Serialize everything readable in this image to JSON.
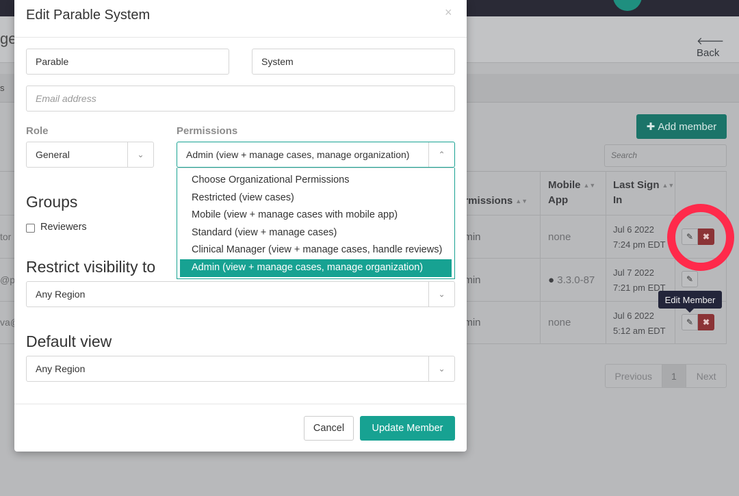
{
  "background": {
    "page_title_fragment": "ge",
    "back_label": "Back",
    "tab_fragment": "s",
    "add_member_label": "Add member",
    "search_placeholder": "Search",
    "table": {
      "headers": {
        "permissions": "Permissions",
        "mobile_app_1": "Mobile",
        "mobile_app_2": "App",
        "last_sign_in_1": "Last Sign",
        "last_sign_in_2": "In"
      },
      "rows": [
        {
          "name_fragment": "tor",
          "permission": "Admin",
          "mobile": "none",
          "date": "Jul 6 2022",
          "time": "7:24 pm EDT"
        },
        {
          "name_fragment": "@pa",
          "permission": "Admin",
          "mobile": "3.3.0-87",
          "date": "Jul 7 2022",
          "time": "7:21 pm EDT"
        },
        {
          "name_fragment": "va@",
          "permission": "Admin",
          "mobile": "none",
          "date": "Jul 6 2022",
          "time": "5:12 am EDT"
        }
      ]
    },
    "tooltip": "Edit Member",
    "pagination": {
      "previous": "Previous",
      "current": "1",
      "next": "Next"
    }
  },
  "modal": {
    "title": "Edit Parable System",
    "close_symbol": "×",
    "first_name": "Parable",
    "last_name": "System",
    "email_placeholder": "Email address",
    "role_label": "Role",
    "role_value": "General",
    "permissions_label": "Permissions",
    "permissions_value": "Admin (view + manage cases, manage organization)",
    "permissions_options": [
      "Choose Organizational Permissions",
      "Restricted (view cases)",
      "Mobile (view + manage cases with mobile app)",
      "Standard (view + manage cases)",
      "Clinical Manager (view + manage cases, handle reviews)",
      "Admin (view + manage cases, manage organization)"
    ],
    "permissions_selected_index": 5,
    "groups_title": "Groups",
    "group_reviewers": "Reviewers",
    "restrict_title": "Restrict visibility to",
    "restrict_value": "Any Region",
    "default_view_title": "Default view",
    "default_view_value": "Any Region",
    "cancel_label": "Cancel",
    "update_label": "Update Member"
  },
  "colors": {
    "accent": "#17a292",
    "danger": "#8b3336",
    "annotation_circle": "#ff2a4b"
  }
}
